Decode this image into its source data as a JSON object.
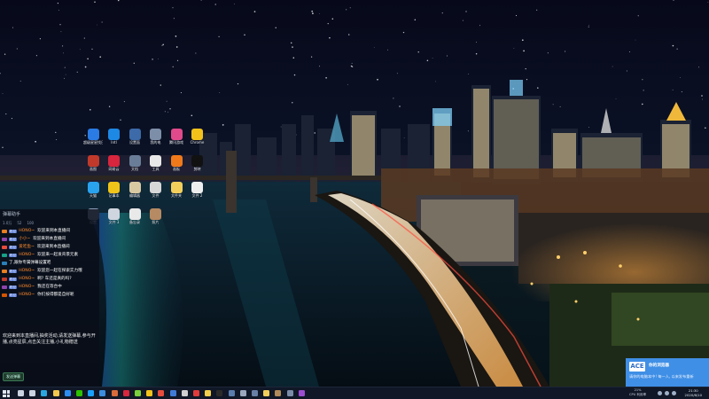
{
  "desktop": {
    "icons": [
      {
        "label": "超级星星找日游",
        "icon": "browser-icon",
        "color": "#2a7be4"
      },
      {
        "label": "Intl",
        "icon": "app-blue-icon",
        "color": "#1e88e5"
      },
      {
        "label": "设置面",
        "icon": "app-teal-icon",
        "color": "#3d6aa8"
      },
      {
        "label": "我的电",
        "icon": "shield-icon",
        "color": "#7d8ea8"
      },
      {
        "label": "腾讯游戏",
        "icon": "game-pink-icon",
        "color": "#e04a8a"
      },
      {
        "label": "Chrome",
        "icon": "chrome-icon",
        "color": "#f2c21b"
      },
      {
        "label": "画图",
        "icon": "paint-icon",
        "color": "#c0392b"
      },
      {
        "label": "网易云",
        "icon": "music-red-icon",
        "color": "#d7263d"
      },
      {
        "label": "文档",
        "icon": "doc-icon",
        "color": "#6a7d98"
      },
      {
        "label": "工具",
        "icon": "tool-icon",
        "color": "#e8e8e8"
      },
      {
        "label": "画板",
        "icon": "palette-icon",
        "color": "#f07a1a"
      },
      {
        "label": "剪映",
        "icon": "capcut-icon",
        "color": "#111111"
      },
      {
        "label": "天猫",
        "icon": "qq-icon",
        "color": "#2aa3ef"
      },
      {
        "label": "记事本",
        "icon": "notepad-icon",
        "color": "#f0c419"
      },
      {
        "label": "编辑器",
        "icon": "editor-icon",
        "color": "#d9c9a3"
      },
      {
        "label": "文件",
        "icon": "file-icon",
        "color": "#d7d7d7"
      },
      {
        "label": "文件夹",
        "icon": "folder-icon",
        "color": "#f2cf5b"
      },
      {
        "label": "文件 2",
        "icon": "file-white-icon",
        "color": "#eeeeee"
      },
      {
        "label": "设置",
        "icon": "settings-icon",
        "color": "#8a9bb5"
      },
      {
        "label": "文件 3",
        "icon": "file-gray-icon",
        "color": "#cfd6df"
      },
      {
        "label": "备忘录",
        "icon": "memo-icon",
        "color": "#e9e9e9"
      },
      {
        "label": "照片",
        "icon": "photo-icon",
        "color": "#b68a63"
      }
    ]
  },
  "chat": {
    "header": "弹幕助手",
    "stats": [
      "1.0万",
      "52",
      "100"
    ],
    "messages": [
      {
        "medal_color": "#e67e22",
        "badge": "粉丝",
        "user": "HONO~",
        "text": "欢迎来到本直播间"
      },
      {
        "medal_color": "#8e44ad",
        "badge": "粉丝",
        "user": "小小~",
        "text": "欢迎来到本直播间"
      },
      {
        "medal_color": "#e74c3c",
        "badge": "粉丝",
        "user": "爱吃鱼~",
        "text": "欢迎来到本直播间"
      },
      {
        "medal_color": "#16a085",
        "badge": "粉丝",
        "user": "HONO~",
        "text": "欢迎来一起发背景元素"
      },
      {
        "medal_color": "#2980b9",
        "badge": "",
        "user": "",
        "text": "了,跟你专属弹幕设置吧"
      },
      {
        "medal_color": "#e67e22",
        "badge": "粉丝",
        "user": "HONO~",
        "text": "欢迎您一起在探索实力哦"
      },
      {
        "medal_color": "#c0392b",
        "badge": "粉丝",
        "user": "HONO~",
        "text": "啊? 车还是真的吗?"
      },
      {
        "medal_color": "#8e44ad",
        "badge": "粉丝",
        "user": "HONO~",
        "text": "我还在等合中"
      },
      {
        "medal_color": "#d35400",
        "badge": "粉丝",
        "user": "HONO~",
        "text": "你们按得都是自好呢"
      }
    ],
    "notice": "欢迎来到本直播间,抽奖活动,请发送弹幕,参与开播,点亮星辰,点击关注主播,小礼物赠送",
    "input_label": "发送弹幕"
  },
  "toast": {
    "logo": "ACE",
    "title": "你的浏览器",
    "body": "请你的电脑本中! 每一人, 以来发布重新"
  },
  "taskbar": {
    "apps": [
      {
        "icon": "search-icon",
        "color": "#c9d3e2"
      },
      {
        "icon": "task-view-icon",
        "color": "#c9d3e2"
      },
      {
        "icon": "edge-icon",
        "color": "#2aa7e0"
      },
      {
        "icon": "file-explorer-icon",
        "color": "#f2c94c"
      },
      {
        "icon": "store-icon",
        "color": "#2d8cf0"
      },
      {
        "icon": "wechat-icon",
        "color": "#2dc100"
      },
      {
        "icon": "qq-icon",
        "color": "#19a0ff"
      },
      {
        "icon": "mail-icon",
        "color": "#3c8dde"
      },
      {
        "icon": "photos-icon",
        "color": "#d96b3b"
      },
      {
        "icon": "netease-music-icon",
        "color": "#d7263d"
      },
      {
        "icon": "games-icon",
        "color": "#7ad03a"
      },
      {
        "icon": "chrome-icon",
        "color": "#f2c21b"
      },
      {
        "icon": "video-icon",
        "color": "#e74c3c"
      },
      {
        "icon": "docs-icon",
        "color": "#3f7bd6"
      },
      {
        "icon": "obs-icon",
        "color": "#d0d0d0"
      },
      {
        "icon": "red-app-icon",
        "color": "#e03a3a"
      },
      {
        "icon": "notes-icon",
        "color": "#f2d04b"
      },
      {
        "icon": "terminal-icon",
        "color": "#2b2b2b"
      },
      {
        "icon": "steam-icon",
        "color": "#5a7dad"
      },
      {
        "icon": "settings-icon",
        "color": "#9aa7bd"
      },
      {
        "icon": "monitor-icon",
        "color": "#6a7fa6"
      },
      {
        "icon": "folder-icon",
        "color": "#f2cf5b"
      },
      {
        "icon": "photo-app-icon",
        "color": "#b08a5a"
      },
      {
        "icon": "camera-icon",
        "color": "#7b8ca8"
      },
      {
        "icon": "purple-app-icon",
        "color": "#9b4dd0"
      }
    ],
    "tray": {
      "cpu": "21%",
      "cpu_label": "CPU 利用率",
      "time": "21:30",
      "date": "2020/6/10"
    }
  },
  "colors": {
    "taskbar_bg": "#101726",
    "toast_bg": "#3f8fe6",
    "chat_user": "#ff8a2b"
  }
}
